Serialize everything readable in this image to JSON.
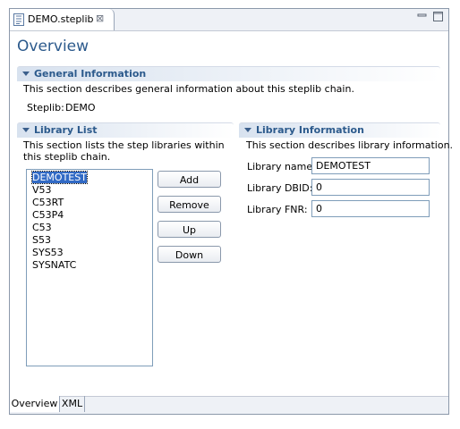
{
  "editor": {
    "tab_title": "DEMO.steplib",
    "tab_icon": "steplib-file-icon",
    "close_icon": "close-icon"
  },
  "page_title": "Overview",
  "general_info": {
    "header": "General Information",
    "description": "This section describes general information about this steplib chain.",
    "steplib_label": "Steplib:",
    "steplib_value": "DEMO"
  },
  "library_list": {
    "header": "Library List",
    "description": "This section lists the step libraries within this steplib chain.",
    "items": [
      "DEMOTEST",
      "V53",
      "C53RT",
      "C53P4",
      "C53",
      "S53",
      "SYS53",
      "SYSNATC"
    ],
    "selected": "DEMOTEST",
    "buttons": {
      "add": "Add",
      "remove": "Remove",
      "up": "Up",
      "down": "Down"
    }
  },
  "library_info": {
    "header": "Library Information",
    "description": "This section describes library information.",
    "name_label": "Library name:",
    "name_value": "DEMOTEST",
    "dbid_label": "Library DBID:",
    "dbid_value": "0",
    "fnr_label": "Library FNR:",
    "fnr_value": "0"
  },
  "bottom_tabs": {
    "overview": "Overview",
    "xml": "XML"
  },
  "colors": {
    "title": "#2c5a8c",
    "border": "#7f9db9",
    "selection": "#316ac5"
  }
}
